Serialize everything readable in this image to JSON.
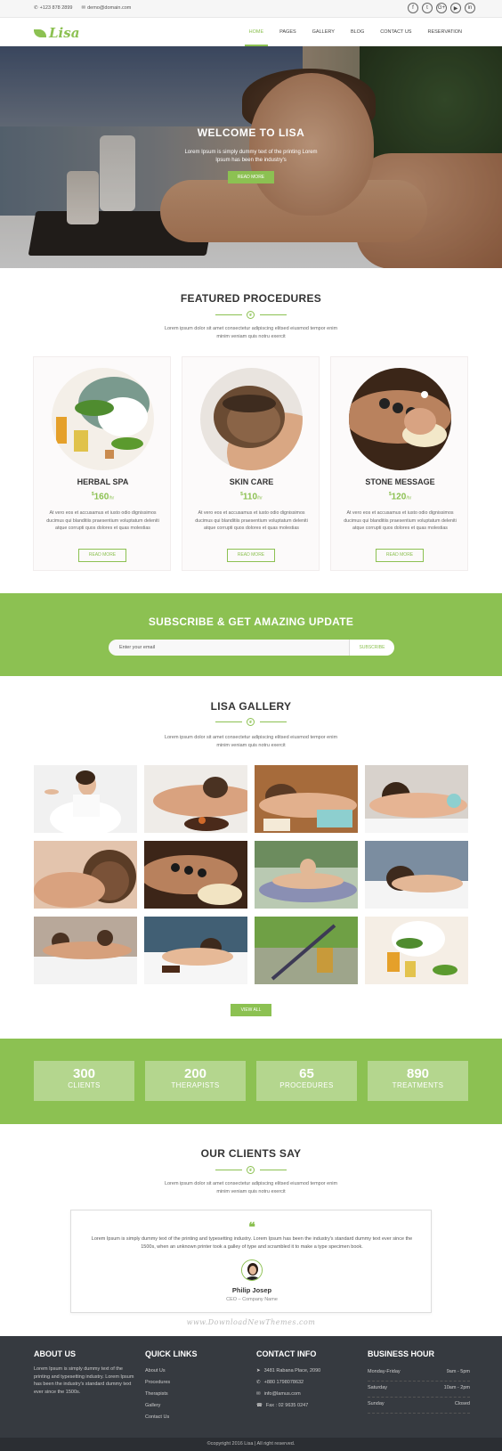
{
  "topbar": {
    "phone": "+123 878 2899",
    "email": "demo@domain.com",
    "social": [
      "f",
      "t",
      "G+",
      "▶",
      "in"
    ]
  },
  "brand": {
    "logo_text": "Lisa"
  },
  "nav": {
    "items": [
      "HOME",
      "PAGES",
      "GALLERY",
      "BLOG",
      "CONTACT US",
      "RESERVATION"
    ],
    "active": "HOME"
  },
  "hero": {
    "title": "WELCOME TO LISA",
    "subtitle": "Lorem Ipsum is simply dummy text of the printing Lorem Ipsum has been the industry's",
    "button": "READ MORE"
  },
  "procedures": {
    "title": "FEATURED PROCEDURES",
    "desc": "Lorem ipsum dolor sit amet consectetur adipiscing elitsed eiusmod tempor enim minim veniam quis notru exercit",
    "cards": [
      {
        "title": "HERBAL SPA",
        "currency": "$",
        "price": "160",
        "unit": "/hr",
        "desc": "At vero eos et accusamus et iusto odio dignissimos ducimus qui blanditiis praesentium voluptatum deleniti atque corrupti quos dolores et quas molestias",
        "button": "READ MORE"
      },
      {
        "title": "SKIN CARE",
        "currency": "$",
        "price": "110",
        "unit": "/hr",
        "desc": "At vero eos et accusamus et iusto odio dignissimos ducimus qui blanditiis praesentium voluptatum deleniti atque corrupti quos dolores et quas molestias",
        "button": "READ MORE"
      },
      {
        "title": "STONE MESSAGE",
        "currency": "$",
        "price": "120",
        "unit": "/hr",
        "desc": "At vero eos et accusamus et iusto odio dignissimos ducimus qui blanditiis praesentium voluptatum deleniti atque corrupti quos dolores et quas molestias",
        "button": "READ MORE"
      }
    ]
  },
  "subscribe": {
    "title": "SUBSCRIBE & GET AMAZING UPDATE",
    "placeholder": "Enter your email",
    "button": "SUBSCRIBE"
  },
  "gallery": {
    "title": "LISA GALLERY",
    "desc": "Lorem ipsum dolor sit amet consectetur adipiscing elitsed eiusmod tempor enim minim veniam quis notru exercit",
    "button": "VIEW ALL"
  },
  "stats": [
    {
      "value": "300",
      "label": "CLIENTS"
    },
    {
      "value": "200",
      "label": "THERAPISTS"
    },
    {
      "value": "65",
      "label": "PROCEDURES"
    },
    {
      "value": "890",
      "label": "TREATMENTS"
    }
  ],
  "clients": {
    "title": "OUR CLIENTS SAY",
    "desc": "Lorem ipsum dolor sit amet consectetur adipiscing elitsed eiusmod tempor enim minim veniam quis notru exercit",
    "quote_mark": "❝",
    "text": "Lorem Ipsum is simply dummy text of the printing and typesetting industry. Lorem Ipsum has been the industry's standard dummy text ever since the 1500s, when an unknown printer took a galley of type and scrambled it to make a type specimen book.",
    "name": "Philip Josep",
    "role": "CEO – Company Name"
  },
  "watermark": "www.DownloadNewThemes.com",
  "footer": {
    "about": {
      "title": "ABOUT US",
      "text": "Lorem Ipsum is simply dummy text of the printing and typesetting industry. Lorem Ipsum has been the industry's standard dummy text ever since the 1500s."
    },
    "links": {
      "title": "QUICK LINKS",
      "items": [
        "About Us",
        "Procedures",
        "Therapists",
        "Gallery",
        "Contact Us"
      ]
    },
    "contact": {
      "title": "CONTACT INFO",
      "items": [
        "3481 Rabana Place, 2090",
        "+880 1798078632",
        "info@lamus.com",
        "Fax : 02 9635 0247"
      ]
    },
    "hours": {
      "title": "BUSINESS HOUR",
      "rows": [
        {
          "day": "Monday-Friday",
          "time": "9am - 5pm"
        },
        {
          "day": "Saturday",
          "time": "10am - 2pm"
        },
        {
          "day": "Sunday",
          "time": "Closed"
        }
      ]
    }
  },
  "copyright": "©copyright 2016 Lisa | All right reserved."
}
